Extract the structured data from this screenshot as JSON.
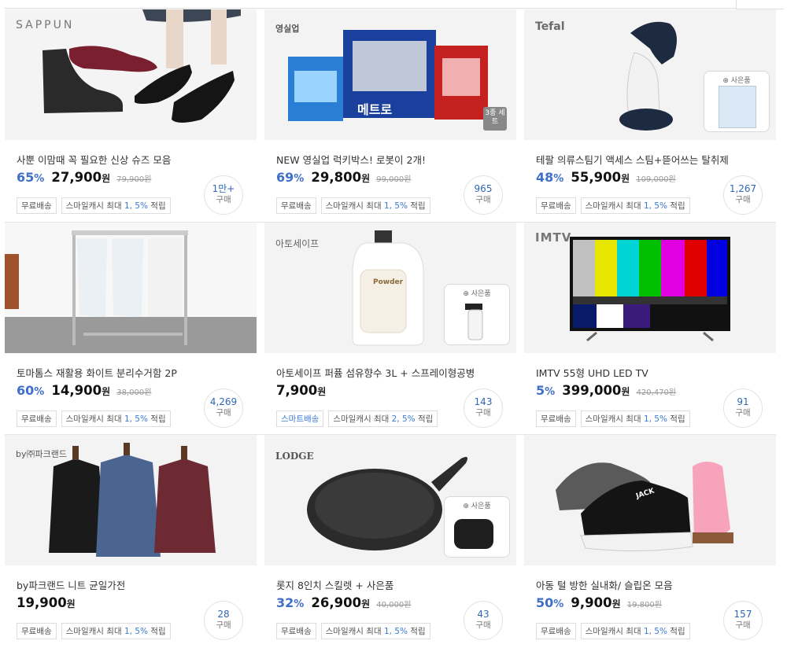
{
  "products": [
    {
      "brand": "SAPPUN",
      "title": "사뿐 이맘때 꼭 필요한 신상 슈즈 모음",
      "discount": "65",
      "price": "27,900",
      "won": "원",
      "original": "79,900원",
      "count": "1만+",
      "count_label": "구매",
      "tags": [
        {
          "text": "무료배송"
        },
        {
          "text": "스마일캐시 최대 ",
          "highlight": "1, 5%",
          "suffix": " 적립"
        }
      ]
    },
    {
      "brand": "영실업",
      "title": "NEW 영실업 럭키박스! 로봇이 2개!",
      "discount": "69",
      "price": "29,800",
      "won": "원",
      "original": "99,000원",
      "count": "965",
      "count_label": "구매",
      "badge": "3종 세트",
      "product_label": "메트로",
      "tags": [
        {
          "text": "무료배송"
        },
        {
          "text": "스마일캐시 최대 ",
          "highlight": "1, 5%",
          "suffix": " 적립"
        }
      ]
    },
    {
      "brand": "Tefal",
      "title": "테팔 의류스팀기 액세스 스팀+뜯어쓰는 탈취제",
      "discount": "48",
      "price": "55,900",
      "won": "원",
      "original": "109,000원",
      "count": "1,267",
      "count_label": "구매",
      "gift": "사은품",
      "tags": [
        {
          "text": "무료배송"
        },
        {
          "text": "스마일캐시 최대 ",
          "highlight": "1, 5%",
          "suffix": " 적립"
        }
      ]
    },
    {
      "brand": "",
      "title": "토마톰스 재활용 화이트 분리수거함 2P",
      "discount": "60",
      "price": "14,900",
      "won": "원",
      "original": "38,000원",
      "count": "4,269",
      "count_label": "구매",
      "tags": [
        {
          "text": "무료배송"
        },
        {
          "text": "스마일캐시 최대 ",
          "highlight": "1, 5%",
          "suffix": " 적립"
        }
      ]
    },
    {
      "brand": "아토세이프",
      "title": "아토세이프 퍼퓸 섬유향수 3L + 스프레이형공병",
      "discount": "",
      "price": "7,900",
      "won": "원",
      "original": "",
      "count": "143",
      "count_label": "구매",
      "gift": "사은품",
      "product_label": "Powder",
      "tags": [
        {
          "text": "스마트배송",
          "smart": true
        },
        {
          "text": "스마일캐시 최대 ",
          "highlight": "2, 5%",
          "suffix": " 적립"
        }
      ]
    },
    {
      "brand": "IMTV",
      "title": "IMTV 55형 UHD LED TV",
      "discount": "5",
      "price": "399,000",
      "won": "원",
      "original": "420,470원",
      "count": "91",
      "count_label": "구매",
      "tags": [
        {
          "text": "무료배송"
        },
        {
          "text": "스마일캐시 최대 ",
          "highlight": "1, 5%",
          "suffix": " 적립"
        }
      ]
    },
    {
      "brand": "by㈜파크랜드",
      "title": "by파크랜드 니트 균일가전",
      "discount": "",
      "price": "19,900",
      "won": "원",
      "original": "",
      "count": "28",
      "count_label": "구매",
      "tags": [
        {
          "text": "무료배송"
        },
        {
          "text": "스마일캐시 최대 ",
          "highlight": "1, 5%",
          "suffix": " 적립"
        }
      ]
    },
    {
      "brand": "LODGE",
      "title": "롯지 8인치 스킬렛 + 사은품",
      "discount": "32",
      "price": "26,900",
      "won": "원",
      "original": "40,000원",
      "count": "43",
      "count_label": "구매",
      "gift": "사은품",
      "tags": [
        {
          "text": "무료배송"
        },
        {
          "text": "스마일캐시 최대 ",
          "highlight": "1, 5%",
          "suffix": " 적립"
        }
      ]
    },
    {
      "brand": "",
      "title": "아동 털 방한 실내화/ 슬립온 모음",
      "discount": "50",
      "price": "9,900",
      "won": "원",
      "original": "19,800원",
      "count": "157",
      "count_label": "구매",
      "product_label": "JACK",
      "tags": [
        {
          "text": "무료배송"
        },
        {
          "text": "스마일캐시 최대 ",
          "highlight": "1, 5%",
          "suffix": " 적립"
        }
      ]
    }
  ]
}
